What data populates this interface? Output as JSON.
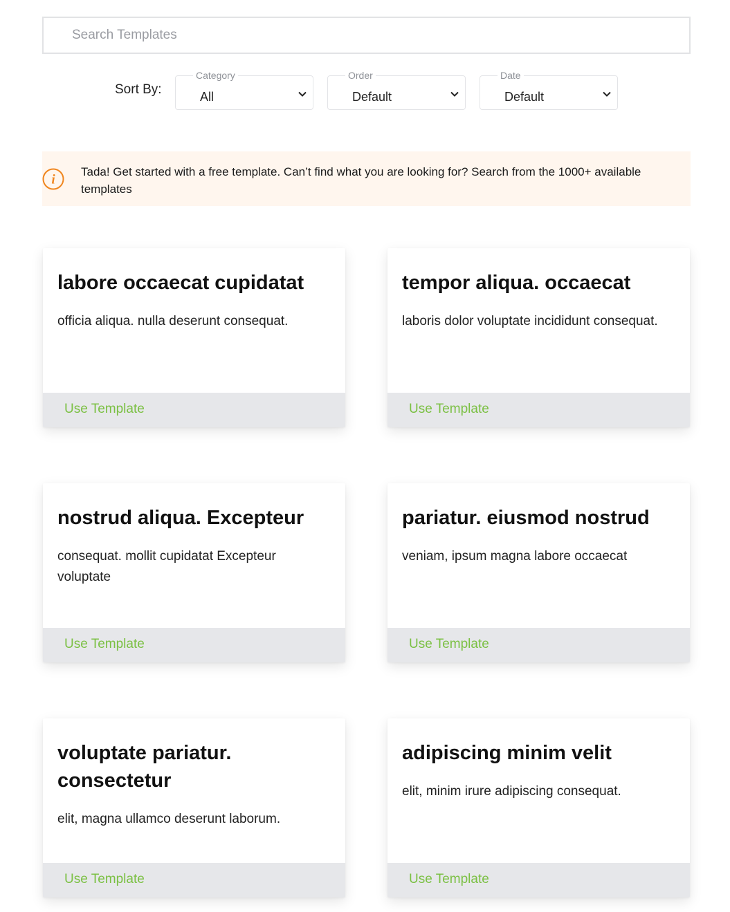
{
  "search": {
    "placeholder": "Search Templates"
  },
  "sort": {
    "label": "Sort By:",
    "category": {
      "legend": "Category",
      "value": "All"
    },
    "order": {
      "legend": "Order",
      "value": "Default"
    },
    "date": {
      "legend": "Date",
      "value": "Default"
    }
  },
  "alert": {
    "icon": "info-icon",
    "message": "Tada! Get started with a free template. Can’t find what you are looking for? Search from the 1000+ available templates",
    "color": "#f0861f"
  },
  "accent": "#7bc043",
  "cards": [
    {
      "title": "labore occaecat cupidatat",
      "description": "officia aliqua. nulla deserunt consequat.",
      "action": "Use Template"
    },
    {
      "title": "tempor aliqua. occaecat",
      "description": "laboris dolor voluptate incididunt consequat.",
      "action": "Use Template"
    },
    {
      "title": "nostrud aliqua. Excepteur",
      "description": "consequat. mollit cupidatat Excepteur voluptate",
      "action": "Use Template"
    },
    {
      "title": "pariatur. eiusmod nostrud",
      "description": "veniam, ipsum magna labore occaecat",
      "action": "Use Template"
    },
    {
      "title": "voluptate pariatur. consectetur",
      "description": "elit, magna ullamco deserunt laborum.",
      "action": "Use Template"
    },
    {
      "title": "adipiscing minim velit",
      "description": "elit, minim irure adipiscing consequat.",
      "action": "Use Template"
    }
  ]
}
